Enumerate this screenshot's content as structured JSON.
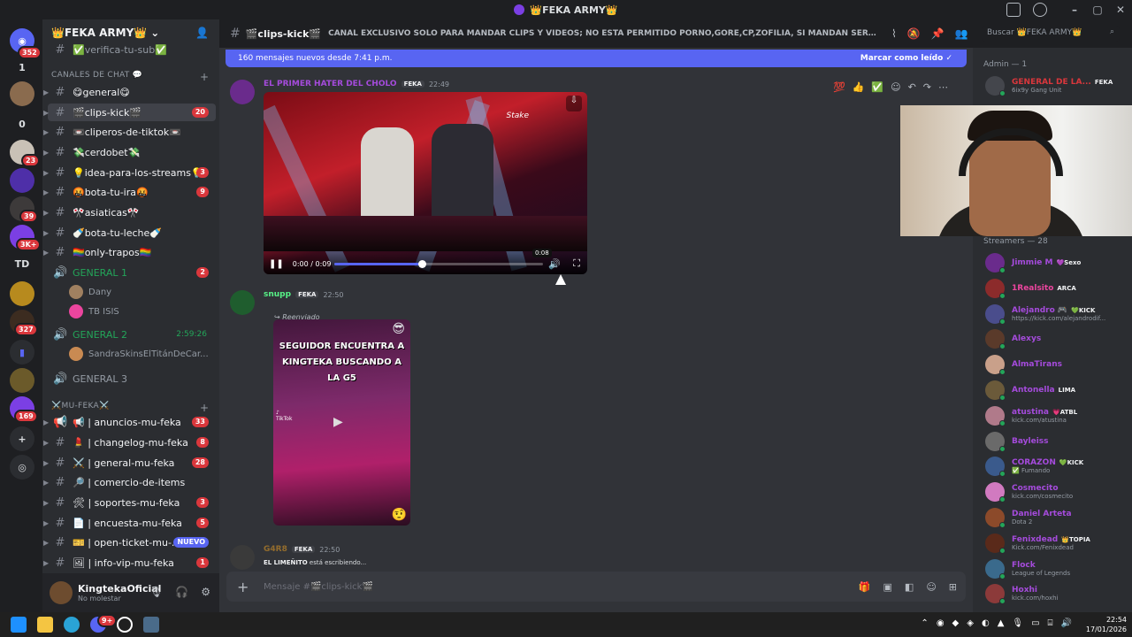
{
  "window": {
    "title": "👑FEKA ARMY👑"
  },
  "rail": {
    "servers": [
      {
        "label": "352"
      },
      {
        "label": "1"
      },
      {
        "label": "0"
      },
      {
        "label": "23"
      },
      {
        "label": "39"
      },
      {
        "label": "3K+"
      },
      {
        "label": "TD"
      },
      {
        "label": "327"
      },
      {
        "label": "169"
      }
    ]
  },
  "sidebar": {
    "guild_name": "👑FEKA ARMY👑",
    "top_channel": "✅verifica-tu-sub✅",
    "category_chat": "CANALES DE CHAT 💬",
    "channels": [
      {
        "name": "😋general😋",
        "count": ""
      },
      {
        "name": "🎬clips-kick🎬",
        "count": "20"
      },
      {
        "name": "📼cliperos-de-tiktok📼",
        "count": ""
      },
      {
        "name": "💸cerdobet💸",
        "count": ""
      },
      {
        "name": "💡idea-para-los-streams💡",
        "count": "3"
      },
      {
        "name": "🤬bota-tu-ira🤬",
        "count": "9"
      },
      {
        "name": "🎌asiaticas🎌",
        "count": ""
      },
      {
        "name": "🍼bota-tu-leche🍼",
        "count": ""
      },
      {
        "name": "🏳️‍🌈only-trapos🏳️‍🌈",
        "count": ""
      }
    ],
    "voice": [
      {
        "name": "GENERAL 1",
        "count": "2",
        "time": ""
      },
      {
        "name": "GENERAL 2",
        "count": "",
        "time": "2:59:26"
      },
      {
        "name": "GENERAL 3",
        "count": "",
        "time": ""
      }
    ],
    "voice_users_g1": [
      "Dany",
      "TB ISIS"
    ],
    "voice_users_g2": [
      "SandraSkinsElTitánDeCar..."
    ],
    "category_mu": "⚔️MU-FEKA⚔️",
    "mu_channels": [
      {
        "name": "📢 | anuncios-mu-feka",
        "count": "33"
      },
      {
        "name": "💄 | changelog-mu-feka",
        "count": "8"
      },
      {
        "name": "⚔️ | general-mu-feka",
        "count": "28"
      },
      {
        "name": "🔎 | comercio-de-items",
        "count": ""
      },
      {
        "name": "🛠 | soportes-mu-feka",
        "count": "3"
      },
      {
        "name": "📄 | encuesta-mu-feka",
        "count": "5"
      },
      {
        "name": "🎫 | open-ticket-mu-...",
        "count": "NUEVO"
      },
      {
        "name": "🖼 | info-vip-mu-feka",
        "count": "1"
      }
    ],
    "user": {
      "name": "KingtekaOficial",
      "status": "No molestar"
    }
  },
  "chat_header": {
    "channel": "🎬clips-kick🎬",
    "topic": "CANAL EXCLUSIVO SOLO PARA MANDAR CLIPS Y VIDEOS; NO ESTA PERMITIDO PORNO,GORE,CP,ZOFILIA, SI MANDAN SERA BANEADO PERMA...",
    "search_placeholder": "Buscar 👑FEKA ARMY👑"
  },
  "chat": {
    "new_messages": "160 mensajes nuevos desde 7:41 p.m.",
    "mark_read": "Marcar como leído",
    "messages": [
      {
        "user": "EL PRIMER HATER DEL CHOLO",
        "tag": "FEKA",
        "time": "22:49",
        "color": "#a54bdc"
      },
      {
        "user": "snupp",
        "tag": "FEKA",
        "time": "22:50",
        "color": "#57f287",
        "forwarded": "Reenviado"
      },
      {
        "user": "G4R8",
        "tag": "FEKA",
        "time": "22:50",
        "color": "#f5a623"
      }
    ],
    "video": {
      "time": "0:00 / 0:09",
      "hover_time": "0:08",
      "progress": 0.42,
      "watermark": "Stake"
    },
    "tiktok": {
      "caption": "SEGUIDOR ENCUENTRA A KINGTEKA BUSCANDO A LA G5",
      "label": "TikTok"
    },
    "typing_user": "EL LIMEÑITO",
    "typing_text": "está escribiendo...",
    "composer_placeholder": "Mensaje #🎬clips-kick🎬"
  },
  "members": {
    "admin_group": "Admin — 1",
    "admin": {
      "name": "GENERAL DE LA...",
      "tag": "FEKA",
      "sub": "6ix9y Gang Unit"
    },
    "streamers_group": "Streamers — 28",
    "list": [
      {
        "name": "Jimmie M",
        "tag": "💜Sexo",
        "sub": "",
        "color": "#a54bdc"
      },
      {
        "name": "1Realsito",
        "tag": "ARCA",
        "sub": "",
        "color": "#eb459e"
      },
      {
        "name": "Alejandro 🎮",
        "tag": "💚KICK",
        "sub": "https://kick.com/alejandrodif...",
        "color": "#a54bdc"
      },
      {
        "name": "Alexys",
        "tag": "",
        "sub": "",
        "color": "#a54bdc"
      },
      {
        "name": "AlmaTirans",
        "tag": "",
        "sub": "",
        "color": "#a54bdc"
      },
      {
        "name": "Antonella",
        "tag": "LIMA",
        "sub": "",
        "color": "#a54bdc"
      },
      {
        "name": "atustina",
        "tag": "💗ATBL",
        "sub": "kick.com/atustina",
        "color": "#a54bdc"
      },
      {
        "name": "Bayleiss",
        "tag": "",
        "sub": "",
        "color": "#a54bdc"
      },
      {
        "name": "CORAZON",
        "tag": "💚KICK",
        "sub": "✅ Fumando",
        "color": "#a54bdc"
      },
      {
        "name": "Cosmecito",
        "tag": "",
        "sub": "kick.com/cosmecito",
        "color": "#a54bdc"
      },
      {
        "name": "Daniel Arteta",
        "tag": "",
        "sub": "Dota 2",
        "color": "#a54bdc"
      },
      {
        "name": "Fenixdead",
        "tag": "👑TOPIA",
        "sub": "Kick.com/Fenixdead",
        "color": "#a54bdc"
      },
      {
        "name": "Flock",
        "tag": "",
        "sub": "League of Legends",
        "color": "#a54bdc"
      },
      {
        "name": "Hoxhi",
        "tag": "",
        "sub": "kick.com/hoxhi",
        "color": "#a54bdc"
      }
    ]
  },
  "taskbar": {
    "time": "22:54",
    "date": "17/01/2026",
    "discord_badge": "9+"
  },
  "colors": {
    "accent": "#5865f2",
    "danger": "#da373c",
    "online": "#23a559"
  }
}
